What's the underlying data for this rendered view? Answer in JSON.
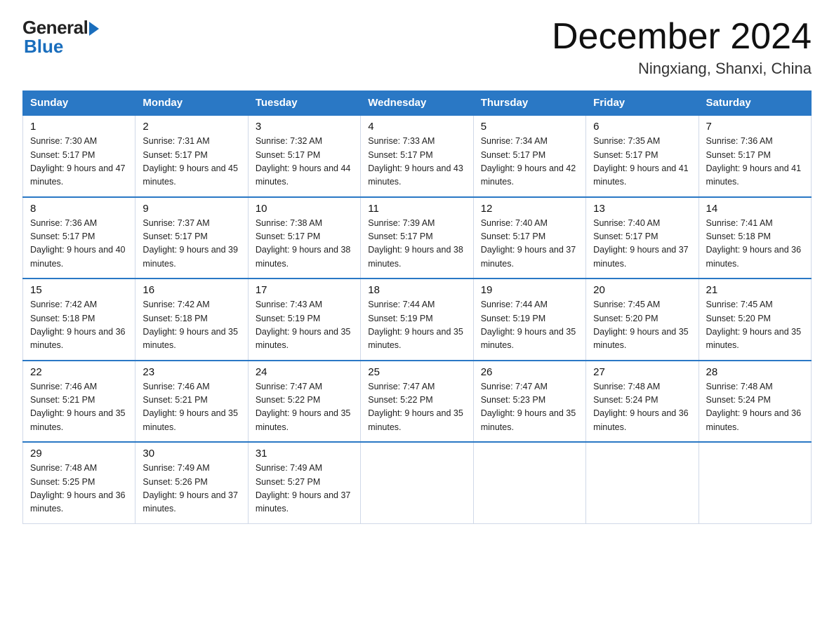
{
  "header": {
    "logo_general": "General",
    "logo_blue": "Blue",
    "month_title": "December 2024",
    "location": "Ningxiang, Shanxi, China"
  },
  "days_of_week": [
    "Sunday",
    "Monday",
    "Tuesday",
    "Wednesday",
    "Thursday",
    "Friday",
    "Saturday"
  ],
  "weeks": [
    [
      {
        "day": "1",
        "sunrise": "7:30 AM",
        "sunset": "5:17 PM",
        "daylight": "9 hours and 47 minutes."
      },
      {
        "day": "2",
        "sunrise": "7:31 AM",
        "sunset": "5:17 PM",
        "daylight": "9 hours and 45 minutes."
      },
      {
        "day": "3",
        "sunrise": "7:32 AM",
        "sunset": "5:17 PM",
        "daylight": "9 hours and 44 minutes."
      },
      {
        "day": "4",
        "sunrise": "7:33 AM",
        "sunset": "5:17 PM",
        "daylight": "9 hours and 43 minutes."
      },
      {
        "day": "5",
        "sunrise": "7:34 AM",
        "sunset": "5:17 PM",
        "daylight": "9 hours and 42 minutes."
      },
      {
        "day": "6",
        "sunrise": "7:35 AM",
        "sunset": "5:17 PM",
        "daylight": "9 hours and 41 minutes."
      },
      {
        "day": "7",
        "sunrise": "7:36 AM",
        "sunset": "5:17 PM",
        "daylight": "9 hours and 41 minutes."
      }
    ],
    [
      {
        "day": "8",
        "sunrise": "7:36 AM",
        "sunset": "5:17 PM",
        "daylight": "9 hours and 40 minutes."
      },
      {
        "day": "9",
        "sunrise": "7:37 AM",
        "sunset": "5:17 PM",
        "daylight": "9 hours and 39 minutes."
      },
      {
        "day": "10",
        "sunrise": "7:38 AM",
        "sunset": "5:17 PM",
        "daylight": "9 hours and 38 minutes."
      },
      {
        "day": "11",
        "sunrise": "7:39 AM",
        "sunset": "5:17 PM",
        "daylight": "9 hours and 38 minutes."
      },
      {
        "day": "12",
        "sunrise": "7:40 AM",
        "sunset": "5:17 PM",
        "daylight": "9 hours and 37 minutes."
      },
      {
        "day": "13",
        "sunrise": "7:40 AM",
        "sunset": "5:17 PM",
        "daylight": "9 hours and 37 minutes."
      },
      {
        "day": "14",
        "sunrise": "7:41 AM",
        "sunset": "5:18 PM",
        "daylight": "9 hours and 36 minutes."
      }
    ],
    [
      {
        "day": "15",
        "sunrise": "7:42 AM",
        "sunset": "5:18 PM",
        "daylight": "9 hours and 36 minutes."
      },
      {
        "day": "16",
        "sunrise": "7:42 AM",
        "sunset": "5:18 PM",
        "daylight": "9 hours and 35 minutes."
      },
      {
        "day": "17",
        "sunrise": "7:43 AM",
        "sunset": "5:19 PM",
        "daylight": "9 hours and 35 minutes."
      },
      {
        "day": "18",
        "sunrise": "7:44 AM",
        "sunset": "5:19 PM",
        "daylight": "9 hours and 35 minutes."
      },
      {
        "day": "19",
        "sunrise": "7:44 AM",
        "sunset": "5:19 PM",
        "daylight": "9 hours and 35 minutes."
      },
      {
        "day": "20",
        "sunrise": "7:45 AM",
        "sunset": "5:20 PM",
        "daylight": "9 hours and 35 minutes."
      },
      {
        "day": "21",
        "sunrise": "7:45 AM",
        "sunset": "5:20 PM",
        "daylight": "9 hours and 35 minutes."
      }
    ],
    [
      {
        "day": "22",
        "sunrise": "7:46 AM",
        "sunset": "5:21 PM",
        "daylight": "9 hours and 35 minutes."
      },
      {
        "day": "23",
        "sunrise": "7:46 AM",
        "sunset": "5:21 PM",
        "daylight": "9 hours and 35 minutes."
      },
      {
        "day": "24",
        "sunrise": "7:47 AM",
        "sunset": "5:22 PM",
        "daylight": "9 hours and 35 minutes."
      },
      {
        "day": "25",
        "sunrise": "7:47 AM",
        "sunset": "5:22 PM",
        "daylight": "9 hours and 35 minutes."
      },
      {
        "day": "26",
        "sunrise": "7:47 AM",
        "sunset": "5:23 PM",
        "daylight": "9 hours and 35 minutes."
      },
      {
        "day": "27",
        "sunrise": "7:48 AM",
        "sunset": "5:24 PM",
        "daylight": "9 hours and 36 minutes."
      },
      {
        "day": "28",
        "sunrise": "7:48 AM",
        "sunset": "5:24 PM",
        "daylight": "9 hours and 36 minutes."
      }
    ],
    [
      {
        "day": "29",
        "sunrise": "7:48 AM",
        "sunset": "5:25 PM",
        "daylight": "9 hours and 36 minutes."
      },
      {
        "day": "30",
        "sunrise": "7:49 AM",
        "sunset": "5:26 PM",
        "daylight": "9 hours and 37 minutes."
      },
      {
        "day": "31",
        "sunrise": "7:49 AM",
        "sunset": "5:27 PM",
        "daylight": "9 hours and 37 minutes."
      },
      null,
      null,
      null,
      null
    ]
  ]
}
